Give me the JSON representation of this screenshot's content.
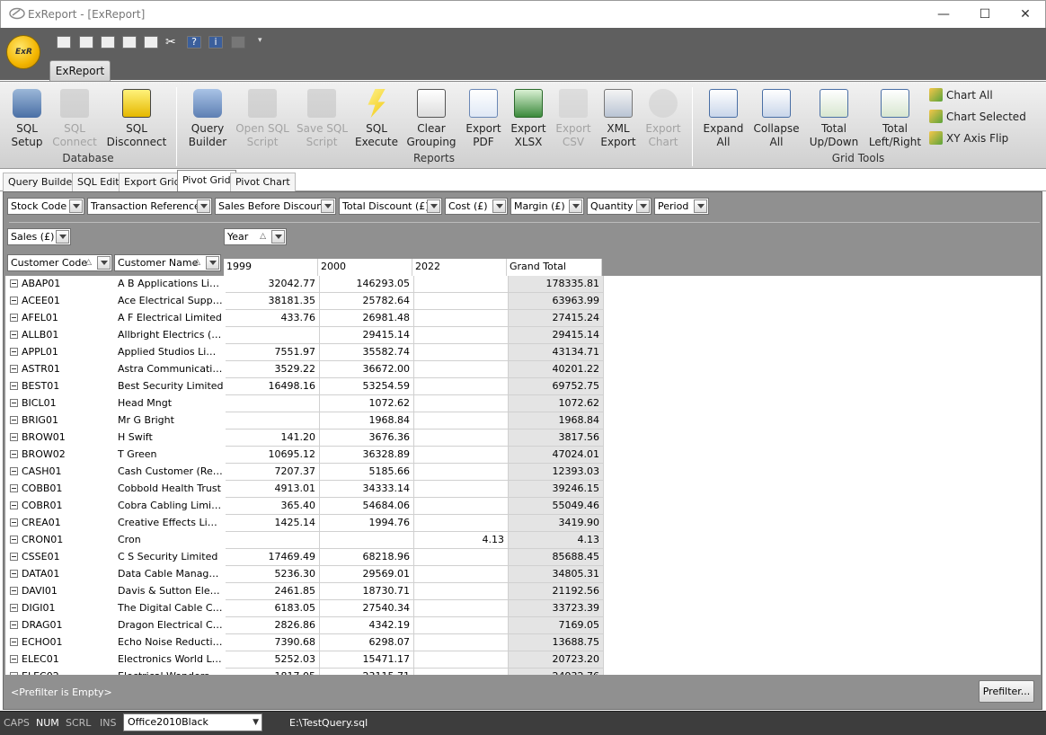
{
  "window": {
    "title": "ExReport - [ExReport]",
    "minimize": "—",
    "maximize": "☐",
    "close": "✕"
  },
  "orb": {
    "label": "ExR"
  },
  "ribbon": {
    "tab": "ExReport",
    "groups": [
      {
        "label": "Database"
      },
      {
        "label": "Reports"
      },
      {
        "label": "Grid Tools"
      }
    ],
    "buttons": {
      "sql_setup": "SQL\nSetup",
      "sql_connect": "SQL\nConnect",
      "sql_disconnect": "SQL\nDisconnect",
      "query_builder": "Query\nBuilder",
      "open_sql_script": "Open SQL\nScript",
      "save_sql_script": "Save SQL\nScript",
      "sql_execute": "SQL\nExecute",
      "clear_grouping": "Clear\nGrouping",
      "export_pdf": "Export\nPDF",
      "export_xlsx": "Export\nXLSX",
      "export_csv": "Export\nCSV",
      "xml_export": "XML\nExport",
      "export_chart": "Export\nChart",
      "expand_all": "Expand\nAll",
      "collapse_all": "Collapse\nAll",
      "total_updown": "Total\nUp/Down",
      "total_leftright": "Total\nLeft/Right"
    },
    "small": {
      "chart_all": "Chart All",
      "chart_selected": "Chart Selected",
      "xy_axis_flip": "XY Axis Flip"
    }
  },
  "doc_tabs": [
    "Query Builder",
    "SQL Edit",
    "Export Grid",
    "Pivot Grid",
    "Pivot Chart"
  ],
  "active_tab": "Pivot Grid",
  "filter_fields": [
    "Stock Code",
    "Transaction Reference",
    "Sales Before Discount",
    "Total Discount (£)",
    "Cost (£)",
    "Margin (£)",
    "Quantity",
    "Period"
  ],
  "data_field": "Sales (£)",
  "column_field": "Year",
  "row_fields": [
    "Customer Code",
    "Customer Name"
  ],
  "columns": [
    "1999",
    "2000",
    "2022",
    "Grand Total"
  ],
  "rows": [
    {
      "code": "ABAP01",
      "name": "A B Applications Limited",
      "v1999": "32042.77",
      "v2000": "146293.05",
      "v2022": "",
      "total": "178335.81"
    },
    {
      "code": "ACEE01",
      "name": "Ace Electrical Supplies",
      "v1999": "38181.35",
      "v2000": "25782.64",
      "v2022": "",
      "total": "63963.99"
    },
    {
      "code": "AFEL01",
      "name": "A F Electrical Limited",
      "v1999": "433.76",
      "v2000": "26981.48",
      "v2022": "",
      "total": "27415.24"
    },
    {
      "code": "ALLB01",
      "name": "Allbright Electrics (Paris)",
      "v1999": "",
      "v2000": "29415.14",
      "v2022": "",
      "total": "29415.14"
    },
    {
      "code": "APPL01",
      "name": "Applied Studios Limited",
      "v1999": "7551.97",
      "v2000": "35582.74",
      "v2022": "",
      "total": "43134.71"
    },
    {
      "code": "ASTR01",
      "name": "Astra Communications Ltd",
      "v1999": "3529.22",
      "v2000": "36672.00",
      "v2022": "",
      "total": "40201.22"
    },
    {
      "code": "BEST01",
      "name": "Best Security Limited",
      "v1999": "16498.16",
      "v2000": "53254.59",
      "v2022": "",
      "total": "69752.75"
    },
    {
      "code": "BICL01",
      "name": "Head Mngt",
      "v1999": "",
      "v2000": "1072.62",
      "v2022": "",
      "total": "1072.62"
    },
    {
      "code": "BRIG01",
      "name": "Mr G Bright",
      "v1999": "",
      "v2000": "1968.84",
      "v2022": "",
      "total": "1968.84"
    },
    {
      "code": "BROW01",
      "name": "H Swift",
      "v1999": "141.20",
      "v2000": "3676.36",
      "v2022": "",
      "total": "3817.56"
    },
    {
      "code": "BROW02",
      "name": "T Green",
      "v1999": "10695.12",
      "v2000": "36328.89",
      "v2022": "",
      "total": "47024.01"
    },
    {
      "code": "CASH01",
      "name": "Cash Customer (Retail)",
      "v1999": "7207.37",
      "v2000": "5185.66",
      "v2022": "",
      "total": "12393.03"
    },
    {
      "code": "COBB01",
      "name": "Cobbold Health Trust",
      "v1999": "4913.01",
      "v2000": "34333.14",
      "v2022": "",
      "total": "39246.15"
    },
    {
      "code": "COBR01",
      "name": "Cobra Cabling Limited",
      "v1999": "365.40",
      "v2000": "54684.06",
      "v2022": "",
      "total": "55049.46"
    },
    {
      "code": "CREA01",
      "name": "Creative Effects Limited",
      "v1999": "1425.14",
      "v2000": "1994.76",
      "v2022": "",
      "total": "3419.90"
    },
    {
      "code": "CRON01",
      "name": "Cron",
      "v1999": "",
      "v2000": "",
      "v2022": "4.13",
      "total": "4.13"
    },
    {
      "code": "CSSE01",
      "name": "C S Security Limited",
      "v1999": "17469.49",
      "v2000": "68218.96",
      "v2022": "",
      "total": "85688.45"
    },
    {
      "code": "DATA01",
      "name": "Data Cable Management",
      "v1999": "5236.30",
      "v2000": "29569.01",
      "v2022": "",
      "total": "34805.31"
    },
    {
      "code": "DAVI01",
      "name": "Davis & Sutton Electrical",
      "v1999": "2461.85",
      "v2000": "18730.71",
      "v2022": "",
      "total": "21192.56"
    },
    {
      "code": "DIGI01",
      "name": "The Digital Cable Company",
      "v1999": "6183.05",
      "v2000": "27540.34",
      "v2022": "",
      "total": "33723.39"
    },
    {
      "code": "DRAG01",
      "name": "Dragon Electrical Contractors",
      "v1999": "2826.86",
      "v2000": "4342.19",
      "v2022": "",
      "total": "7169.05"
    },
    {
      "code": "ECHO01",
      "name": "Echo Noise Reduction Ltd",
      "v1999": "7390.68",
      "v2000": "6298.07",
      "v2022": "",
      "total": "13688.75"
    },
    {
      "code": "ELEC01",
      "name": "Electronics World Limited",
      "v1999": "5252.03",
      "v2000": "15471.17",
      "v2022": "",
      "total": "20723.20"
    },
    {
      "code": "ELEC02",
      "name": "Electrical Wonders",
      "v1999": "1817.05",
      "v2000": "23115.71",
      "v2022": "",
      "total": "24932.76"
    }
  ],
  "prefilter": {
    "text": "<Prefilter is Empty>",
    "button": "Prefilter..."
  },
  "status": {
    "caps": "CAPS",
    "num": "NUM",
    "scrl": "SCRL",
    "ins": "INS",
    "theme": "Office2010Black",
    "file": "E:\\TestQuery.sql"
  }
}
